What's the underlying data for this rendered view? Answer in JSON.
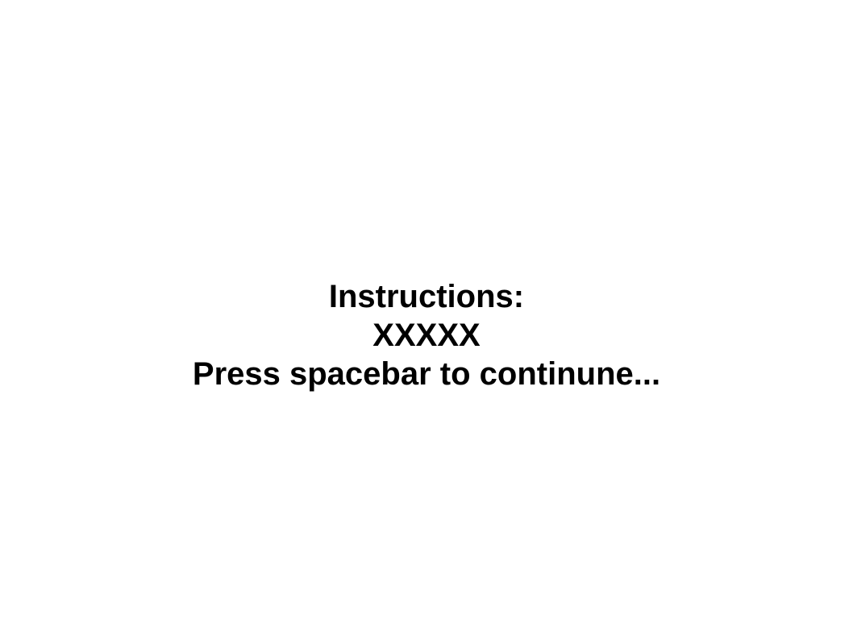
{
  "screen": {
    "heading": "Instructions:",
    "body": "XXXXX",
    "prompt": "Press spacebar to continune..."
  },
  "colors": {
    "background": "#ffffff",
    "text": "#000000"
  }
}
